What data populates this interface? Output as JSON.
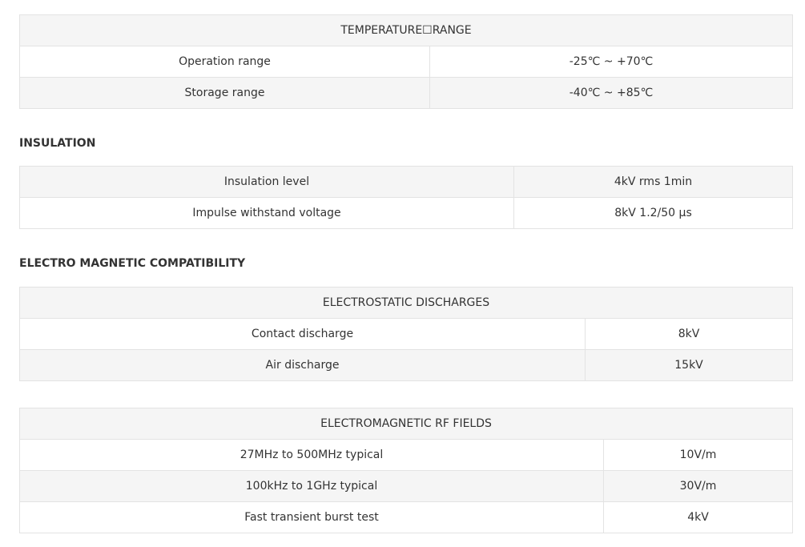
{
  "temperature": {
    "title": "TEMPERATURE☐RANGE",
    "rows": [
      {
        "label": "Operation range",
        "value": "-25℃ ~ +70℃"
      },
      {
        "label": "Storage range",
        "value": "-40℃ ~ +85℃"
      }
    ]
  },
  "insulation": {
    "heading": "INSULATION",
    "rows": [
      {
        "label": "Insulation level",
        "value": "4kV rms 1min"
      },
      {
        "label": "Impulse withstand voltage",
        "value": "8kV 1.2/50 μs"
      }
    ]
  },
  "emc": {
    "heading": "ELECTRO MAGNETIC COMPATIBILITY",
    "esd": {
      "title": "ELECTROSTATIC DISCHARGES",
      "rows": [
        {
          "label": "Contact discharge",
          "value": "8kV"
        },
        {
          "label": "Air discharge",
          "value": "15kV"
        }
      ]
    },
    "rf": {
      "title": "ELECTROMAGNETIC RF FIELDS",
      "rows": [
        {
          "label": "27MHz to 500MHz typical",
          "value": "10V/m"
        },
        {
          "label": "100kHz to 1GHz typical",
          "value": "30V/m"
        },
        {
          "label": "Fast transient burst test",
          "value": "4kV"
        }
      ]
    }
  }
}
